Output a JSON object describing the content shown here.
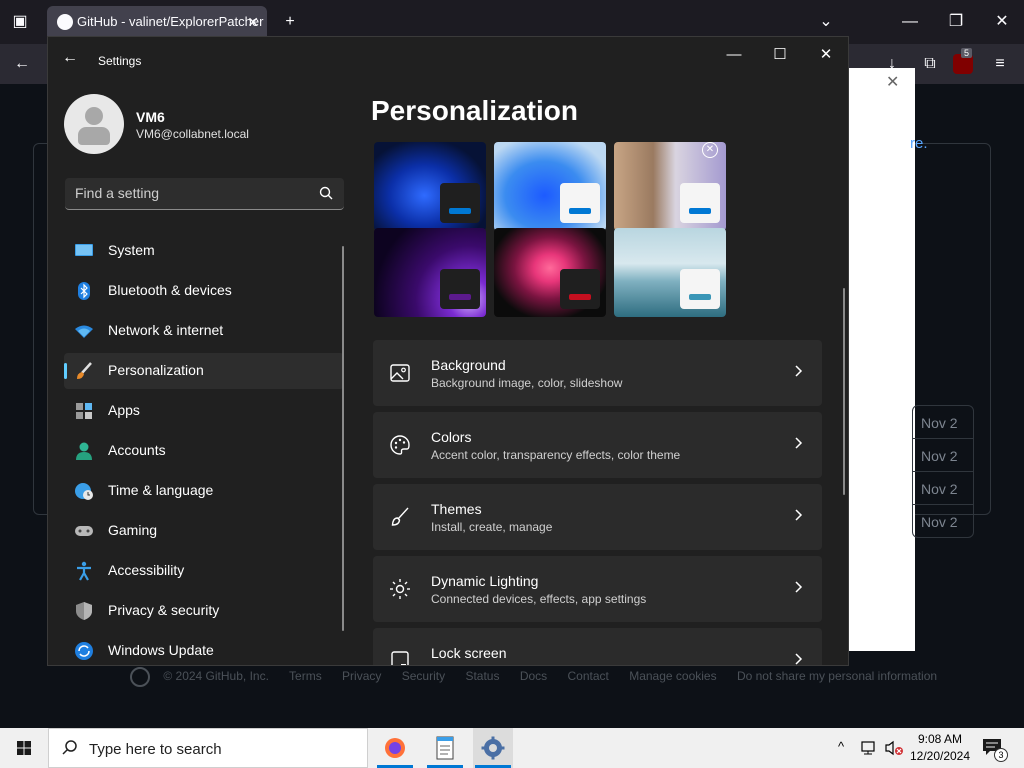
{
  "browser": {
    "tab_title": "GitHub - valinet/ExplorerPatcher",
    "new_tab_label": "+",
    "extension_badge": "5"
  },
  "github_page": {
    "link_fragment": "re.",
    "dates": [
      "Nov 2",
      "Nov 2",
      "Nov 2",
      "Nov 2"
    ],
    "footer_links": [
      "© 2024 GitHub, Inc.",
      "Terms",
      "Privacy",
      "Security",
      "Status",
      "Docs",
      "Contact",
      "Manage cookies",
      "Do not share my personal information"
    ]
  },
  "settings": {
    "window_title": "Settings",
    "profile": {
      "name": "VM6",
      "email": "VM6@collabnet.local"
    },
    "search": {
      "placeholder": "Find a setting"
    },
    "nav": [
      {
        "label": "System",
        "icon": "system-icon",
        "active": false
      },
      {
        "label": "Bluetooth & devices",
        "icon": "bluetooth-icon",
        "active": false
      },
      {
        "label": "Network & internet",
        "icon": "wifi-icon",
        "active": false
      },
      {
        "label": "Personalization",
        "icon": "paintbrush-icon",
        "active": true
      },
      {
        "label": "Apps",
        "icon": "apps-icon",
        "active": false
      },
      {
        "label": "Accounts",
        "icon": "accounts-icon",
        "active": false
      },
      {
        "label": "Time & language",
        "icon": "globe-clock-icon",
        "active": false
      },
      {
        "label": "Gaming",
        "icon": "gamepad-icon",
        "active": false
      },
      {
        "label": "Accessibility",
        "icon": "accessibility-icon",
        "active": false
      },
      {
        "label": "Privacy & security",
        "icon": "shield-icon",
        "active": false
      },
      {
        "label": "Windows Update",
        "icon": "update-icon",
        "active": false
      }
    ],
    "page_title": "Personalization",
    "themes": [
      {
        "name": "windows-dark",
        "accent": "#0078d4"
      },
      {
        "name": "windows-light",
        "accent": "#0078d4"
      },
      {
        "name": "glow",
        "accent": "#0078d4"
      },
      {
        "name": "captured-motion",
        "accent": "#5c1a8c"
      },
      {
        "name": "flow",
        "accent": "#c50f1f"
      },
      {
        "name": "sunrise",
        "accent": "#3a96b7"
      }
    ],
    "cards": [
      {
        "title": "Background",
        "desc": "Background image, color, slideshow",
        "icon": "image-icon"
      },
      {
        "title": "Colors",
        "desc": "Accent color, transparency effects, color theme",
        "icon": "palette-icon"
      },
      {
        "title": "Themes",
        "desc": "Install, create, manage",
        "icon": "brush-icon"
      },
      {
        "title": "Dynamic Lighting",
        "desc": "Connected devices, effects, app settings",
        "icon": "lighting-icon"
      },
      {
        "title": "Lock screen",
        "desc": "",
        "icon": "lock-screen-icon"
      }
    ]
  },
  "taskbar": {
    "search_placeholder": "Type here to search",
    "time": "9:08 AM",
    "date": "12/20/2024",
    "notification_count": "3"
  },
  "colors": {
    "accent": "#60cdff",
    "window_bg": "#202020",
    "card_bg": "#2b2b2b"
  }
}
